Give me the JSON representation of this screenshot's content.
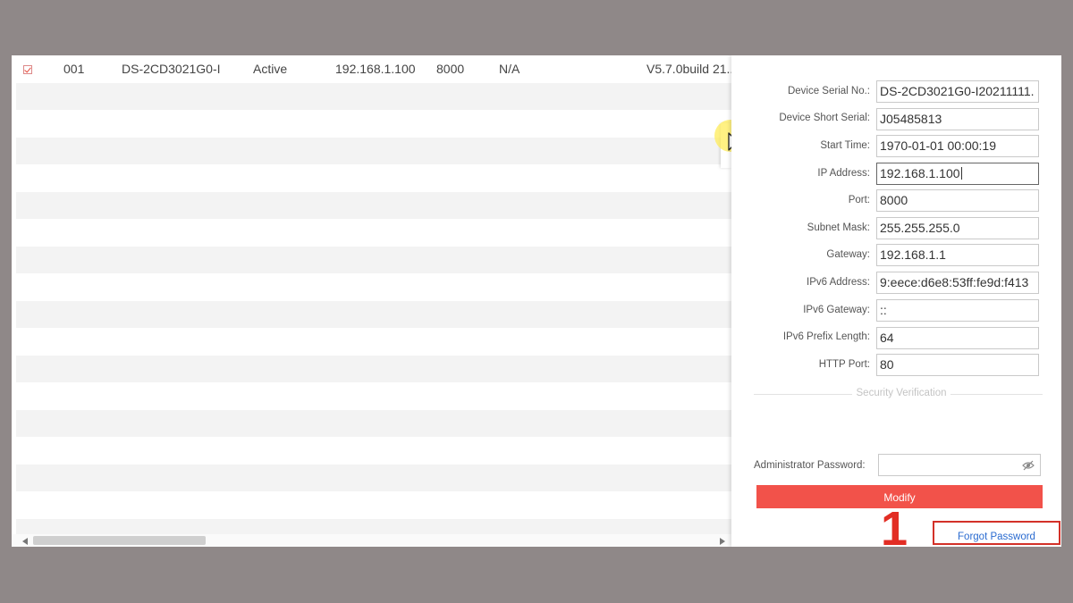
{
  "device_list": {
    "row": {
      "checked": true,
      "index": "001",
      "model": "DS-2CD3021G0-I",
      "status": "Active",
      "ip": "192.168.1.100",
      "port": "8000",
      "col7": "N/A",
      "version": "V5.7.0build 21..."
    }
  },
  "panel": {
    "fields": [
      {
        "label": "Device Serial No.:",
        "value": "DS-2CD3021G0-I20211111."
      },
      {
        "label": "Device Short Serial:",
        "value": "J05485813"
      },
      {
        "label": "Start Time:",
        "value": "1970-01-01 00:00:19"
      },
      {
        "label": "IP Address:",
        "value": "192.168.1.100"
      },
      {
        "label": "Port:",
        "value": "8000"
      },
      {
        "label": "Subnet Mask:",
        "value": "255.255.255.0"
      },
      {
        "label": "Gateway:",
        "value": "192.168.1.1"
      },
      {
        "label": "IPv6 Address:",
        "value": "9:eece:d6e8:53ff:fe9d:f413"
      },
      {
        "label": "IPv6 Gateway:",
        "value": "::"
      },
      {
        "label": "IPv6 Prefix Length:",
        "value": "64"
      },
      {
        "label": "HTTP Port:",
        "value": "80"
      }
    ],
    "security_title": "Security Verification",
    "admin_password_label": "Administrator Password:",
    "admin_password_value": "",
    "modify_label": "Modify",
    "annotation_number": "1",
    "forgot_password_label": "Forgot Password"
  },
  "colors": {
    "accent_red": "#f2524a",
    "annotation_red": "#e22d24",
    "link_blue": "#2a6bd0",
    "cursor_highlight": "#ffec5a"
  },
  "icons": {
    "checkbox": "checkbox-checked-icon",
    "cursor": "mouse-pointer-icon",
    "password_toggle": "eye-slash-icon"
  }
}
